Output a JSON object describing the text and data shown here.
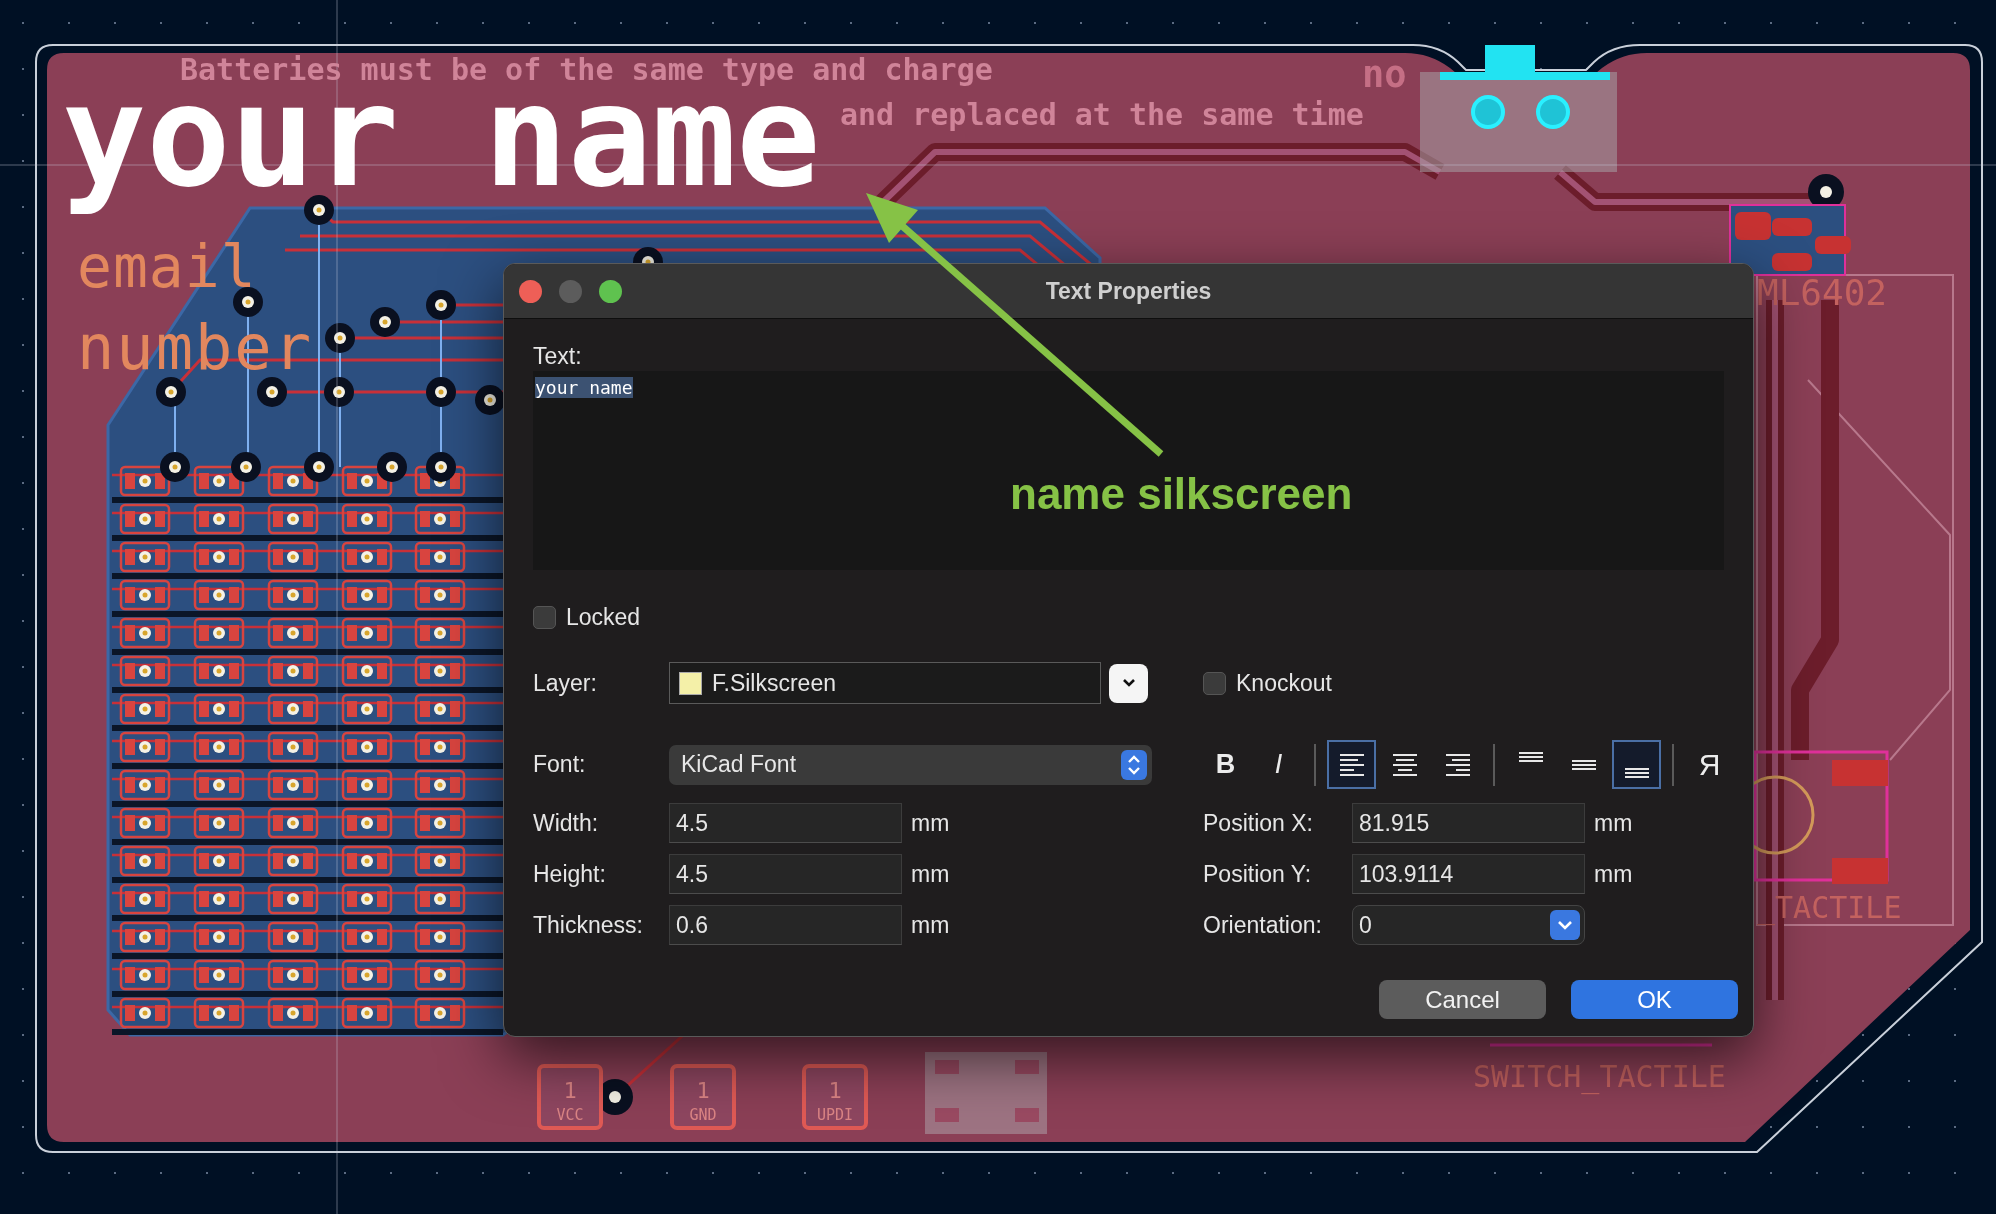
{
  "board": {
    "silkscreen": [
      {
        "text": "Batteries must be of the same type and charge",
        "kind": "back"
      },
      {
        "text": "and replaced at the same time",
        "kind": "back"
      },
      {
        "text": "no",
        "kind": "faint"
      },
      {
        "text": "your name",
        "kind": "highlight"
      },
      {
        "text": "email",
        "kind": "front"
      },
      {
        "text": "number",
        "kind": "front"
      },
      {
        "text": "ML6402",
        "kind": "fab"
      },
      {
        "text": "_TACTILE",
        "kind": "fab"
      },
      {
        "text": "SWITCH_TACTILE",
        "kind": "fab"
      }
    ],
    "connectors": [
      {
        "pin": "1",
        "label": "VCC"
      },
      {
        "pin": "1",
        "label": "GND"
      },
      {
        "pin": "1",
        "label": "UPDI"
      }
    ]
  },
  "annotation": {
    "label": "name silkscreen"
  },
  "dialog": {
    "title": "Text Properties",
    "text_label": "Text:",
    "text_value": "your name",
    "locked": {
      "label": "Locked",
      "checked": false
    },
    "layer": {
      "label": "Layer:",
      "value": "F.Silkscreen"
    },
    "knockout": {
      "label": "Knockout",
      "checked": false
    },
    "font": {
      "label": "Font:",
      "value": "KiCad Font"
    },
    "toolbar": [
      {
        "kind": "bold",
        "label": "B",
        "selected": false
      },
      {
        "kind": "italic",
        "label": "I",
        "selected": false
      },
      {
        "kind": "align_left",
        "selected": true
      },
      {
        "kind": "align_center",
        "selected": false
      },
      {
        "kind": "align_right",
        "selected": false
      },
      {
        "kind": "valign_top",
        "selected": false
      },
      {
        "kind": "valign_middle",
        "selected": false
      },
      {
        "kind": "valign_bottom",
        "selected": true
      },
      {
        "kind": "mirror",
        "label": "Я",
        "selected": false
      }
    ],
    "fields_left": [
      {
        "label": "Width:",
        "value": "4.5",
        "unit": "mm"
      },
      {
        "label": "Height:",
        "value": "4.5",
        "unit": "mm"
      },
      {
        "label": "Thickness:",
        "value": "0.6",
        "unit": "mm"
      }
    ],
    "fields_right": [
      {
        "kind": "text",
        "label": "Position X:",
        "value": "81.915",
        "unit": "mm"
      },
      {
        "kind": "text",
        "label": "Position Y:",
        "value": "103.9114",
        "unit": "mm"
      },
      {
        "kind": "dropdown",
        "label": "Orientation:",
        "value": "0"
      }
    ],
    "buttons": [
      {
        "label": "Cancel",
        "kind": "secondary"
      },
      {
        "label": "OK",
        "kind": "primary"
      }
    ]
  }
}
